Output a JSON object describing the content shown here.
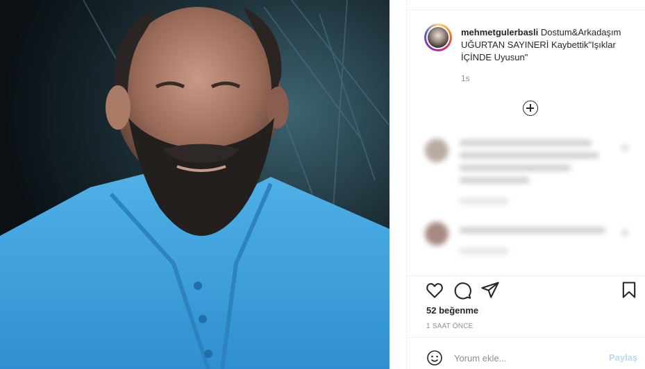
{
  "post": {
    "username": "mehmetgulerbasli",
    "caption": "Dostum&Arkadaşım UĞURTAN SAYINERİ Kaybettik\"Işıklar İÇİNDE Uyusun\"",
    "time_ago": "1s",
    "likes": "52 beğenme",
    "date": "1 SAAT ÖNCE"
  },
  "comment_box": {
    "placeholder": "Yorum ekle...",
    "post_label": "Paylaş"
  },
  "icons": {
    "load_more": "plus-circle-icon",
    "like": "heart-icon",
    "comment": "comment-bubble-icon",
    "share": "paper-plane-icon",
    "save": "bookmark-icon",
    "emoji": "smiley-icon"
  },
  "colors": {
    "post_button_disabled": "#b3dbff",
    "text": "#262626",
    "muted": "#8e8e8e"
  }
}
